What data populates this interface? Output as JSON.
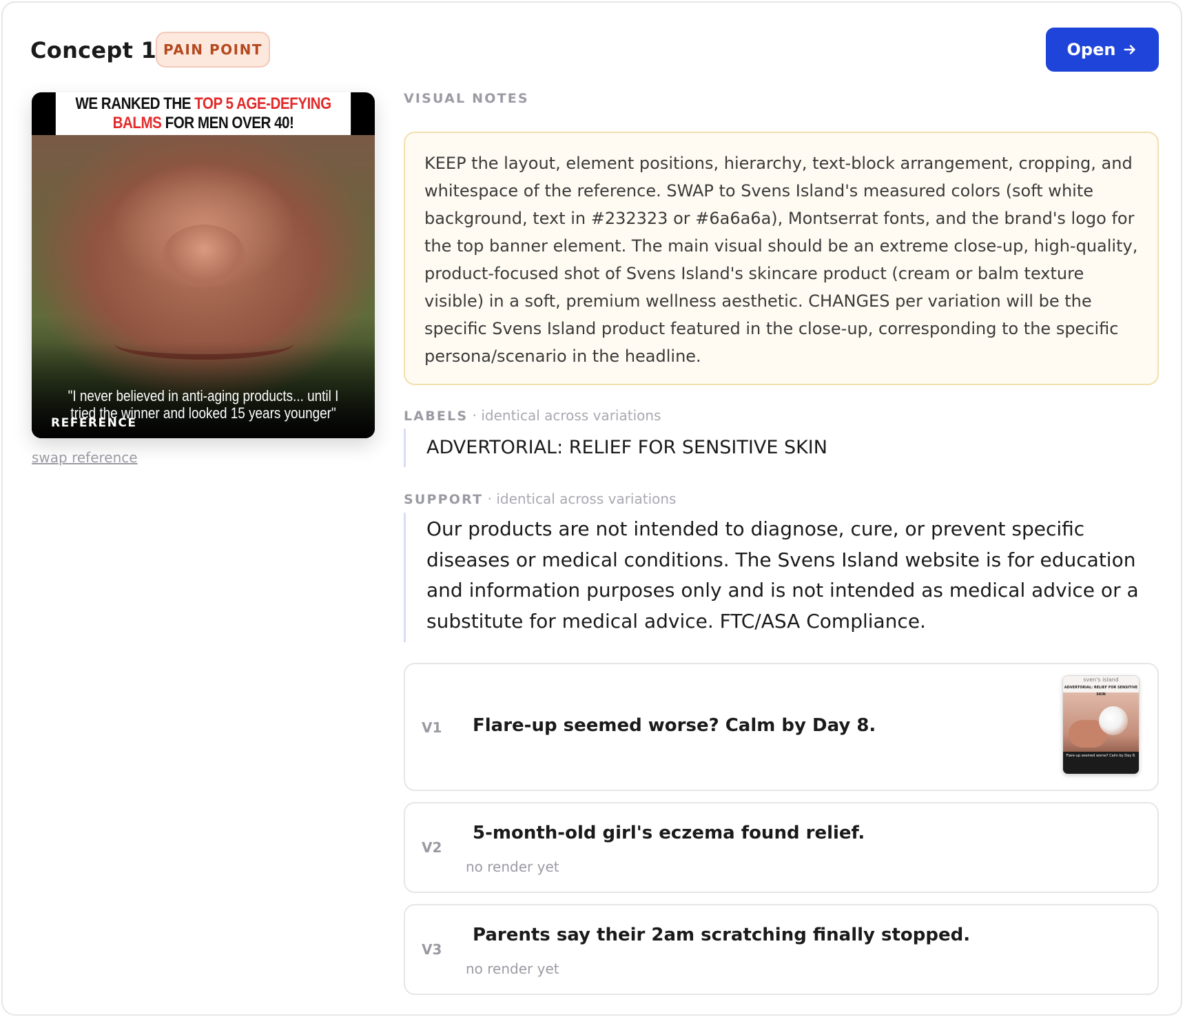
{
  "concept": {
    "title": "Concept 1",
    "badge": "PAIN POINT",
    "open_label": "Open"
  },
  "reference": {
    "headline_line1_black": "WE RANKED THE ",
    "headline_line1_red": "TOP 5 AGE-DEFYING",
    "headline_line2_red": "BALMS",
    "headline_line2_black": " FOR MEN OVER 40!",
    "quote": "\"I never believed in anti-aging products... until I tried the winner and looked 15 years younger\"",
    "label": "REFERENCE",
    "swap_link": "swap reference"
  },
  "visual_notes": {
    "heading": "VISUAL NOTES",
    "text": "KEEP the layout, element positions, hierarchy, text-block arrangement, cropping, and whitespace of the reference. SWAP to Svens Island's measured colors (soft white background, text in #232323 or #6a6a6a), Montserrat fonts, and the brand's logo for the top banner element. The main visual should be an extreme close-up, high-quality, product-focused shot of Svens Island's skincare product (cream or balm texture visible) in a soft, premium wellness aesthetic. CHANGES per variation will be the specific Svens Island product featured in the close-up, corresponding to the specific persona/scenario in the headline."
  },
  "labels": {
    "heading": "LABELS",
    "sub": " · identical across variations",
    "text": "ADVERTORIAL: RELIEF FOR SENSITIVE SKIN"
  },
  "support": {
    "heading": "SUPPORT",
    "sub": " · identical across variations",
    "text": "Our products are not intended to diagnose, cure, or prevent specific diseases or medical conditions. The Svens Island website is for education and information purposes only and is not intended as medical advice or a substitute for medical advice. FTC/ASA Compliance."
  },
  "variations": [
    {
      "id": "V1",
      "title": "Flare-up seemed worse? Calm by Day 8.",
      "thumb_brand": "sven's island",
      "thumb_banner": "ADVERTORIAL: RELIEF FOR SENSITIVE SKIN",
      "thumb_caption": "Flare-up seemed worse? Calm by Day 8."
    },
    {
      "id": "V2",
      "title": "5-month-old girl's eczema found relief.",
      "status": "no render yet"
    },
    {
      "id": "V3",
      "title": "Parents say their 2am scratching finally stopped.",
      "status": "no render yet"
    }
  ],
  "colors": {
    "accent": "#1f44d9",
    "badge_bg": "#fde8de",
    "badge_text": "#b4491f",
    "notes_bg": "#fffbf2",
    "notes_border": "#f1dfae",
    "muted": "#9a9aa3",
    "headline_red": "#e22b2b"
  },
  "icons": {
    "open_arrow": "arrow-right-icon"
  }
}
